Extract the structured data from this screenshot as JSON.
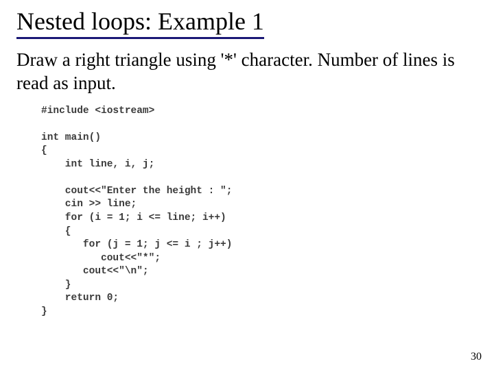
{
  "title": "Nested loops: Example 1",
  "subtitle": "Draw a right triangle using '*' character. Number of lines is read as input.",
  "code": "#include <iostream>\n\nint main()\n{\n    int line, i, j;\n\n    cout<<\"Enter the height : \";\n    cin >> line;\n    for (i = 1; i <= line; i++)\n    {\n       for (j = 1; j <= i ; j++)\n          cout<<\"*\";\n       cout<<\"\\n\";\n    }\n    return 0;\n}",
  "page_number": "30"
}
